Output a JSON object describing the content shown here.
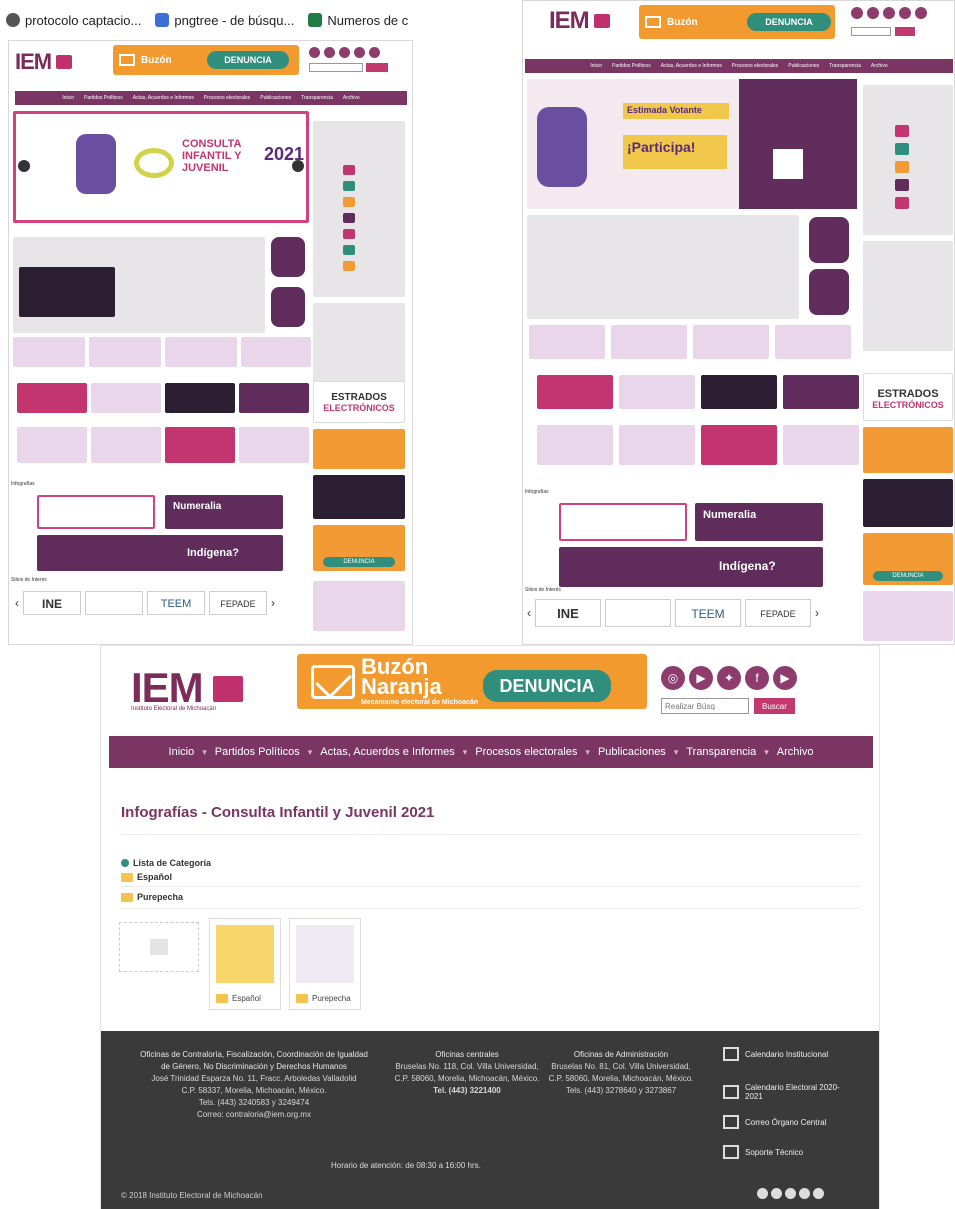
{
  "bookmarks": [
    {
      "label": "protocolo captacio...",
      "icon": "globe-icon",
      "color": "#555555"
    },
    {
      "label": "pngtree - de búsqu...",
      "icon": "pngtree-icon",
      "color": "#3b6fd6"
    },
    {
      "label": "Numeros de c",
      "icon": "excel-icon",
      "color": "#1f7a44"
    }
  ],
  "brand": {
    "logo_text": "IEM",
    "logo_sub": "Instituto Electoral de Michoacán",
    "buzon_line1": "Buzón",
    "buzon_line2": "Naranja",
    "buzon_sub": "Mecanismo electoral de Michoacán",
    "denuncia": "DENUNCIA",
    "search_placeholder": "Realizar Búsq",
    "search_button": "Buscar",
    "social_icons": [
      "instagram-icon",
      "youtube-icon",
      "twitter-icon",
      "facebook-icon",
      "youtube-icon"
    ],
    "colors": {
      "plum": "#7a3563",
      "pink": "#c2356f",
      "orange": "#f39a2e",
      "teal": "#2f8f7c"
    }
  },
  "nav": [
    "Inicio",
    "Partidos Políticos",
    "Actas, Acuerdos e Informes",
    "Procesos electorales",
    "Publicaciones",
    "Transparencia",
    "Archivo"
  ],
  "mini_left": {
    "banner_title": "CONSULTA INFANTIL Y JUVENIL",
    "banner_year": "2021",
    "sidebar_labels": [
      "Estrados Electrónicos"
    ],
    "estrados_line1": "ESTRADOS",
    "estrados_line2": "ELECTRÓNICOS",
    "logos": [
      "INE",
      "TEEM",
      "FEPADE"
    ],
    "numeralia": "Numeralia",
    "indigena": "Indígena?",
    "sections": [
      "Infografías",
      "Sitios de Interés"
    ]
  },
  "mini_right": {
    "banner_participa": "¡Participa!",
    "banner_title": "Estimada Votante",
    "estrados_line1": "ESTRADOS",
    "estrados_line2": "ELECTRÓNICOS",
    "logos": [
      "INE",
      "TEEM",
      "FEPADE"
    ],
    "numeralia": "Numeralia",
    "indigena": "Indígena?",
    "sections": [
      "Infografías",
      "Sitios de Interés"
    ]
  },
  "main": {
    "page_title": "Infografías - Consulta Infantil y Juvenil 2021",
    "list_label": "Lista de Categoría",
    "categories": [
      "Español",
      "Purepecha"
    ],
    "thumbs": [
      {
        "caption": ""
      },
      {
        "caption": "Español"
      },
      {
        "caption": "Purepecha"
      }
    ]
  },
  "footer": {
    "col1": {
      "title": "Oficinas de Contraloría, Fiscalización, Coordinación de Igualdad de Género, No Discriminación y Derechos Humanos",
      "line1": "José Trinidad Esparza No. 11, Fracc. Arboledas Valladolid",
      "line2": "C.P. 58337, Morelia, Michoacán, México.",
      "line3": "Tels. (443) 3240583 y 3249474",
      "line4": "Correo: contraloria@iem.org.mx"
    },
    "col2": {
      "title": "Oficinas centrales",
      "line1": "Bruselas No. 118, Col. Villa Universidad,",
      "line2": "C.P. 58060, Morelia, Michoacán, México.",
      "line3": "Tel. (443) 3221400"
    },
    "col3": {
      "title": "Oficinas de Administración",
      "line1": "Bruselas No. 81, Col. Villa Universidad,",
      "line2": "C.P. 58060, Morelia, Michoacán, México.",
      "line3": "Tels. (443) 3278640 y 3273867"
    },
    "links": [
      {
        "label": "Calendario Institucional",
        "icon": "calendar-icon"
      },
      {
        "label": "Calendario Electoral 2020-2021",
        "icon": "calendar-icon"
      },
      {
        "label": "Correo Órgano Central",
        "icon": "mail-icon"
      },
      {
        "label": "Soporte Técnico",
        "icon": "support-icon"
      }
    ],
    "horario": "Horario de atención: de 08:30 a 16:00 hrs.",
    "copyright": "© 2018 Instituto Electoral de Michoacán",
    "social_icons": [
      "instagram-icon",
      "youtube-icon",
      "twitter-icon",
      "facebook-icon",
      "youtube-icon"
    ]
  }
}
